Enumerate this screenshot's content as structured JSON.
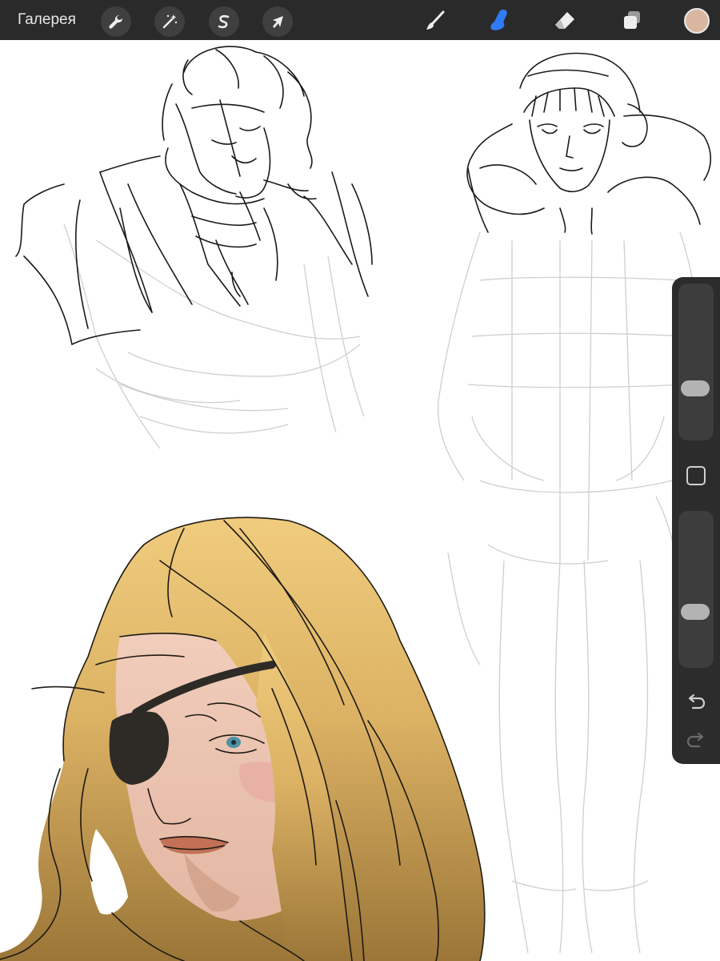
{
  "toolbar": {
    "gallery_label": "Галерея",
    "actions_icon": "wrench-icon",
    "adjustments_icon": "magic-wand-icon",
    "selection_icon": "selection-s-icon",
    "transform_icon": "cursor-arrow-icon",
    "brush_icon": "brush-icon",
    "smudge_icon": "smudge-finger-icon",
    "eraser_icon": "eraser-icon",
    "layers_icon": "layers-icon",
    "active_tool": "smudge",
    "current_color": "#d8b6a0",
    "active_tool_color": "#2f7cf6"
  },
  "sidebar": {
    "brush_size_level": 0.3,
    "opacity_level": 0.33,
    "modify_icon": "square-icon",
    "undo_icon": "undo-icon",
    "redo_icon": "redo-icon"
  },
  "colors": {
    "bar": "#2a2a2a",
    "sketch_dark": "#1a1a1a",
    "sketch_light": "#cfcfcf",
    "hair_light": "#ecc779",
    "hair_dark": "#9b7638",
    "skin": "#ebc5b3",
    "eyepatch": "#2e2b27",
    "iris": "#4d93a3",
    "lips": "#c27156"
  }
}
